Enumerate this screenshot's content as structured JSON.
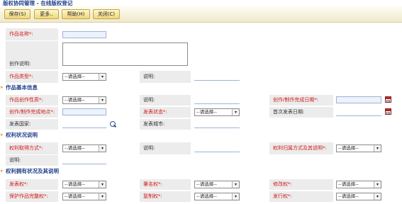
{
  "window": {
    "title": "版权协同管理 - 在线版权登记"
  },
  "toolbar": {
    "save_label": "保存(S)",
    "more_label": "更多..",
    "help_label": "帮助(H)",
    "close_label": "关闭(C)"
  },
  "select_placeholder": "--请选择--",
  "dropdown_glyph": "▾",
  "work": {
    "name_label": "作品名称*:",
    "description_label": "创作说明:",
    "type_label": "作品类型*:",
    "type_note_label": "说明:"
  },
  "sections": {
    "basic_info": "作品基本信息",
    "rights_status": "权利状况说明",
    "rights_owned": "权利拥有状况及其说明"
  },
  "basic": {
    "nature_label": "作品创作性质*:",
    "nature_note_label": "说明:",
    "completion_date_label": "创作/制作完成日期*:",
    "completion_place_label": "创作/制作完成地点*:",
    "publish_status_label": "发表状态*:",
    "first_publish_date_label": "首次发表日期:",
    "publish_country_label": "发表国家:",
    "publish_city_label": "发表城市:"
  },
  "rights": {
    "acquire_label": "权利取得方式*:",
    "acquire_note_label": "说明:",
    "ownership_label": "权利归属方式及其说明*:",
    "ownership_note_label": "说明:"
  },
  "owned": {
    "publish_right": "发表权*:",
    "attribution_right": "署名权*:",
    "modify_right": "修改权*:",
    "integrity_right": "保护作品完整权*:",
    "reproduction_right": "复制权*:",
    "distribution_right": "发行权*:"
  }
}
